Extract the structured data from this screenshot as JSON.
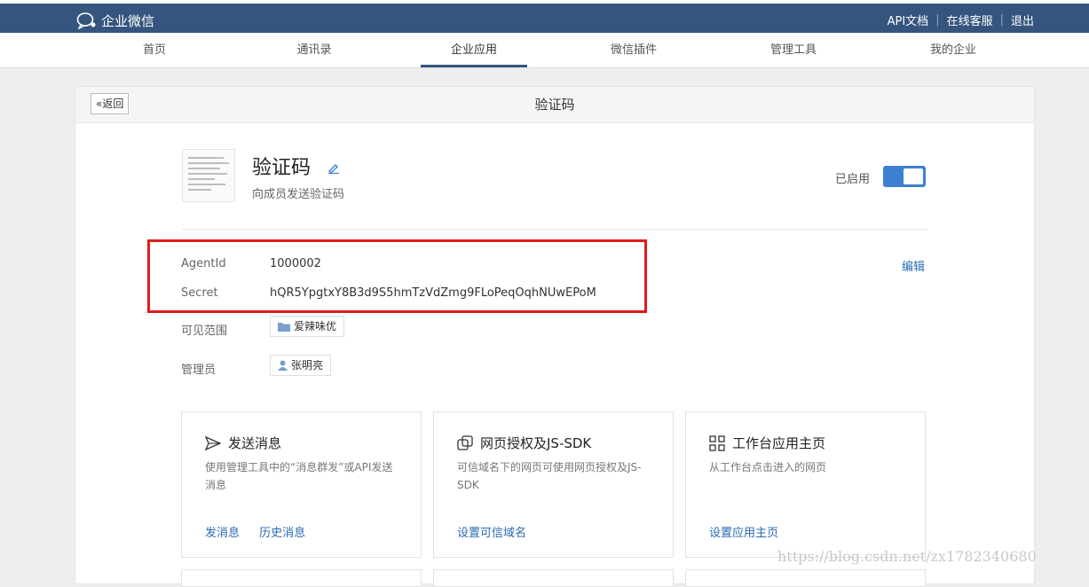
{
  "topbar": {
    "brand": "企业微信",
    "links": [
      "API文档",
      "在线客服",
      "退出"
    ],
    "separator": "|"
  },
  "nav": {
    "items": [
      "首页",
      "通讯录",
      "企业应用",
      "微信插件",
      "管理工具",
      "我的企业"
    ],
    "active": "企业应用"
  },
  "header": {
    "back_label": "返回",
    "title": "验证码"
  },
  "app": {
    "name": "验证码",
    "description": "向成员发送验证码",
    "status_label": "已启用",
    "enabled": true
  },
  "credentials": {
    "agentid_label": "AgentId",
    "agentid_value": "1000002",
    "secret_label": "Secret",
    "secret_value": "hQR5YpgtxY8B3d9S5hmTzVdZmg9FLoPeqOqhNUwEPoM",
    "edit_label": "编辑"
  },
  "scope": {
    "label": "可见范围",
    "value": "爱辣味优"
  },
  "admin": {
    "label": "管理员",
    "value": "张明亮"
  },
  "features": [
    {
      "title": "发送消息",
      "icon": "send-icon",
      "description": "使用管理工具中的“消息群发”或API发送消息",
      "links": [
        "发消息",
        "历史消息"
      ]
    },
    {
      "title": "网页授权及JS-SDK",
      "icon": "link-icon",
      "description": "可信域名下的网页可使用网页授权及JS-SDK",
      "links": [
        "设置可信域名"
      ]
    },
    {
      "title": "工作台应用主页",
      "icon": "grid-icon",
      "description": "从工作台点击进入的网页",
      "links": [
        "设置应用主页"
      ]
    }
  ],
  "watermark": "https://blog.csdn.net/zx1782340680",
  "colors": {
    "topbar": "#35557e",
    "toggle": "#3d7fd1",
    "link": "#2a6ab0",
    "highlight_box": "#e01b1b"
  }
}
